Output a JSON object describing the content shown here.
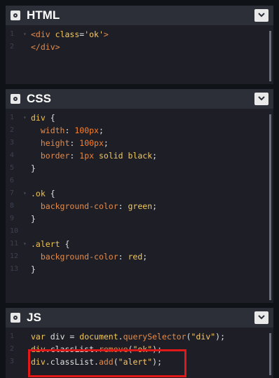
{
  "panels": {
    "html": {
      "title": "HTML",
      "lines": [
        {
          "n": "1",
          "fold": "▾",
          "html": "<span class=\"t-tag\">&lt;div</span> <span class=\"t-attr\">class</span><span class=\"t-plain\">=</span><span class=\"t-str\">'ok'</span><span class=\"t-tag\">&gt;</span>"
        },
        {
          "n": "2",
          "fold": "",
          "html": "<span class=\"t-tag\">&lt;/div&gt;</span>"
        }
      ]
    },
    "css": {
      "title": "CSS",
      "lines": [
        {
          "n": "1",
          "fold": "▾",
          "html": "<span class=\"t-sel\">div</span> <span class=\"t-plain\">{</span>"
        },
        {
          "n": "2",
          "fold": "",
          "html": "  <span class=\"t-prop\">width</span><span class=\"t-plain\">: </span><span class=\"t-num\">100px</span><span class=\"t-plain\">;</span>"
        },
        {
          "n": "3",
          "fold": "",
          "html": "  <span class=\"t-prop\">height</span><span class=\"t-plain\">: </span><span class=\"t-num\">100px</span><span class=\"t-plain\">;</span>"
        },
        {
          "n": "4",
          "fold": "",
          "html": "  <span class=\"t-prop\">border</span><span class=\"t-plain\">: </span><span class=\"t-num\">1px</span> <span class=\"t-val\">solid black</span><span class=\"t-plain\">;</span>"
        },
        {
          "n": "5",
          "fold": "",
          "html": "<span class=\"t-plain\">}</span>"
        },
        {
          "n": "6",
          "fold": "",
          "html": ""
        },
        {
          "n": "7",
          "fold": "▾",
          "html": "<span class=\"t-sel\">.ok</span> <span class=\"t-plain\">{</span>"
        },
        {
          "n": "8",
          "fold": "",
          "html": "  <span class=\"t-prop\">background-color</span><span class=\"t-plain\">: </span><span class=\"t-val\">green</span><span class=\"t-plain\">;</span>"
        },
        {
          "n": "9",
          "fold": "",
          "html": "<span class=\"t-plain\">}</span>"
        },
        {
          "n": "10",
          "fold": "",
          "html": ""
        },
        {
          "n": "11",
          "fold": "▾",
          "html": "<span class=\"t-sel\">.alert</span> <span class=\"t-plain\">{</span>"
        },
        {
          "n": "12",
          "fold": "",
          "html": "  <span class=\"t-prop\">background-color</span><span class=\"t-plain\">: </span><span class=\"t-val\">red</span><span class=\"t-plain\">;</span>"
        },
        {
          "n": "13",
          "fold": "",
          "html": "<span class=\"t-plain\">}</span>"
        }
      ]
    },
    "js": {
      "title": "JS",
      "lines": [
        {
          "n": "1",
          "fold": "",
          "html": "<span class=\"t-kw\">var</span> <span class=\"t-plain\">div = </span><span class=\"t-kw\">document</span><span class=\"t-plain\">.</span><span class=\"t-fn\">querySelector</span><span class=\"t-plain\">(</span><span class=\"t-str\">\"div\"</span><span class=\"t-plain\">);</span>"
        },
        {
          "n": "2",
          "fold": "",
          "html": "<span class=\"t-kw\">div</span><span class=\"t-plain\">.classList.</span><span class=\"t-fn\">remove</span><span class=\"t-plain\">(</span><span class=\"t-str\">\"ok\"</span><span class=\"t-plain\">);</span>"
        },
        {
          "n": "3",
          "fold": "",
          "html": "<span class=\"t-kw\">div</span><span class=\"t-plain\">.classList.</span><span class=\"t-fn\">add</span><span class=\"t-plain\">(</span><span class=\"t-str\">\"alert\"</span><span class=\"t-plain\">);</span>"
        }
      ]
    }
  },
  "colors": {
    "background": "#0f1216",
    "panel": "#1e1f26",
    "header": "#2c2f38",
    "highlight_box": "#e01818"
  }
}
